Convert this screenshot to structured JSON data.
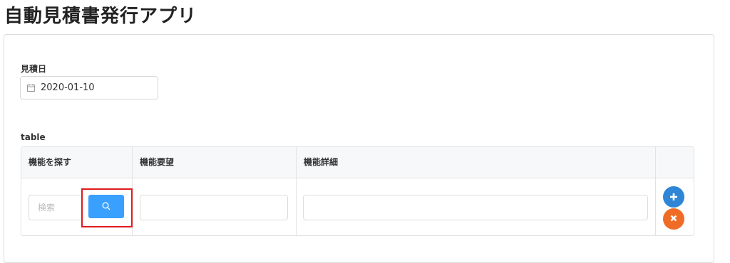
{
  "app": {
    "title": "自動見積書発行アプリ"
  },
  "form": {
    "date_label": "見積日",
    "date_value": "2020-01-10",
    "table_label": "table"
  },
  "table": {
    "columns": [
      "機能を探す",
      "機能要望",
      "機能詳細"
    ],
    "search_placeholder": "検索",
    "row": {
      "request_value": "",
      "detail_value": ""
    }
  },
  "icons": {
    "calendar": "calendar-icon",
    "search": "search-icon",
    "add": "plus-icon",
    "remove": "close-icon"
  },
  "colors": {
    "search_button": "#3aa0ff",
    "add_button": "#2f86d6",
    "remove_button": "#ef6c26",
    "highlight": "#e01b1b"
  }
}
